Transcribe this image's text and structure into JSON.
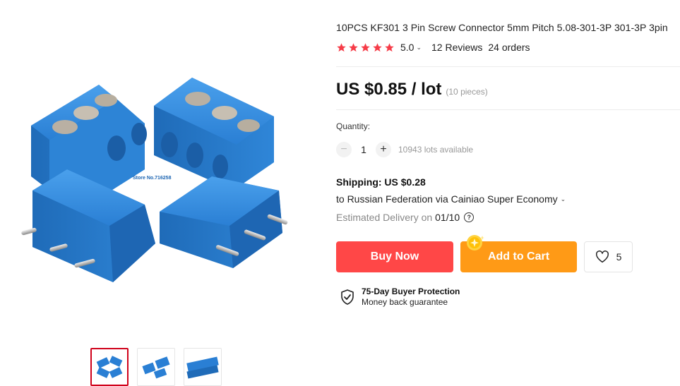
{
  "product": {
    "title": "10PCS KF301 3 Pin Screw Connector 5mm Pitch 5.08-301-3P 301-3P 3pin",
    "rating": "5.0",
    "rating_stars": 5,
    "reviews": "12 Reviews",
    "orders": "24 orders",
    "price": "US $0.85 / lot",
    "pieces": "(10 pieces)",
    "image_watermark": "Store No.716258"
  },
  "quantity": {
    "label": "Quantity:",
    "value": "1",
    "minus": "−",
    "plus": "+",
    "available": "10943 lots available"
  },
  "shipping": {
    "label": "Shipping: US $0.28",
    "route": "to Russian Federation via Cainiao Super Economy",
    "delivery_label": "Estimated Delivery on",
    "delivery_date": "01/10",
    "help_icon": "?"
  },
  "actions": {
    "buy_now": "Buy Now",
    "add_to_cart": "Add to Cart",
    "wishlist_count": "5"
  },
  "protection": {
    "title": "75-Day Buyer Protection",
    "subtitle": "Money back guarantee"
  },
  "colors": {
    "buy_now": "#ff4747",
    "add_to_cart": "#ff9a16",
    "star": "#f63c48",
    "connector_blue": "#2a7fd4",
    "selected_thumb_border": "#d0021b"
  },
  "gallery": {
    "selected_index": 0,
    "thumb_count": 3
  }
}
